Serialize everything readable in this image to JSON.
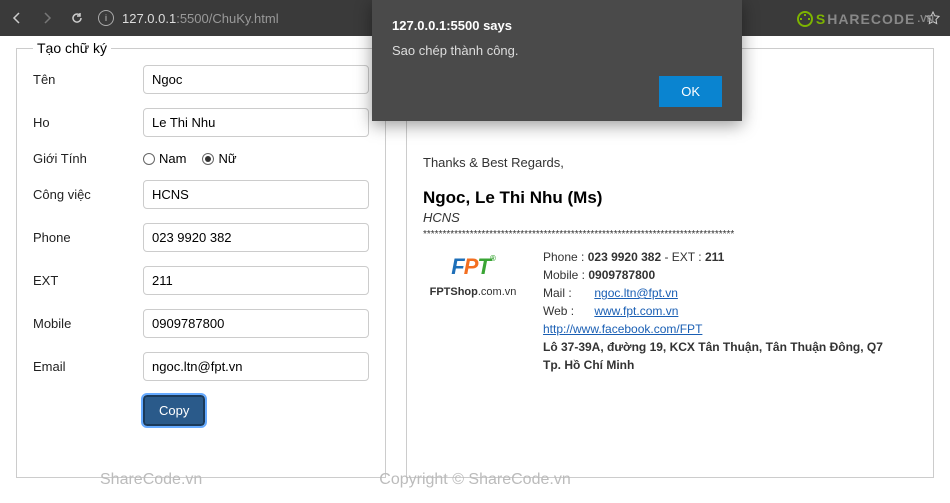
{
  "browser": {
    "url_host": "127.0.0.1",
    "url_rest": ":5500/ChuKy.html"
  },
  "watermark": {
    "brand_s": "S",
    "brand_rest": "HARECODE",
    "brand_vn": ".VN",
    "center": "Copyright © ShareCode.vn",
    "left": "ShareCode.vn"
  },
  "form": {
    "legend": "Tạo chữ ký",
    "rows": {
      "ten": {
        "label": "Tên",
        "value": "Ngoc"
      },
      "ho": {
        "label": "Ho",
        "value": "Le Thi Nhu"
      },
      "gioitinh": {
        "label": "Giới Tính",
        "nam": "Nam",
        "nu": "Nữ"
      },
      "congviec": {
        "label": "Công việc",
        "value": "HCNS"
      },
      "phone": {
        "label": "Phone",
        "value": "023 9920 382"
      },
      "ext": {
        "label": "EXT",
        "value": "211"
      },
      "mobile": {
        "label": "Mobile",
        "value": "0909787800"
      },
      "email": {
        "label": "Email",
        "value": "ngoc.ltn@fpt.vn"
      }
    },
    "copy_btn": "Copy"
  },
  "preview": {
    "regards": "Thanks & Best Regards,",
    "name": "Ngoc, Le Thi Nhu (Ms)",
    "role": "HCNS",
    "divider": "********************************************************************************",
    "fptshop": "FPTShop.com.vn",
    "phone_lbl": "Phone :",
    "phone_val": "023 9920 382",
    "ext_lbl": "- EXT :",
    "ext_val": "211",
    "mobile_lbl": "Mobile :",
    "mobile_val": "0909787800",
    "mail_lbl": "Mail :",
    "mail_val": "ngoc.ltn@fpt.vn",
    "web_lbl": "Web :",
    "web_val": "www.fpt.com.vn",
    "fb": "http://www.facebook.com/FPT",
    "addr1": "Lô 37-39A, đường 19, KCX Tân Thuận, Tân Thuận Đông, Q7",
    "addr2": "Tp. Hồ Chí Minh"
  },
  "alert": {
    "title": "127.0.0.1:5500 says",
    "msg": "Sao chép thành công.",
    "ok": "OK"
  }
}
